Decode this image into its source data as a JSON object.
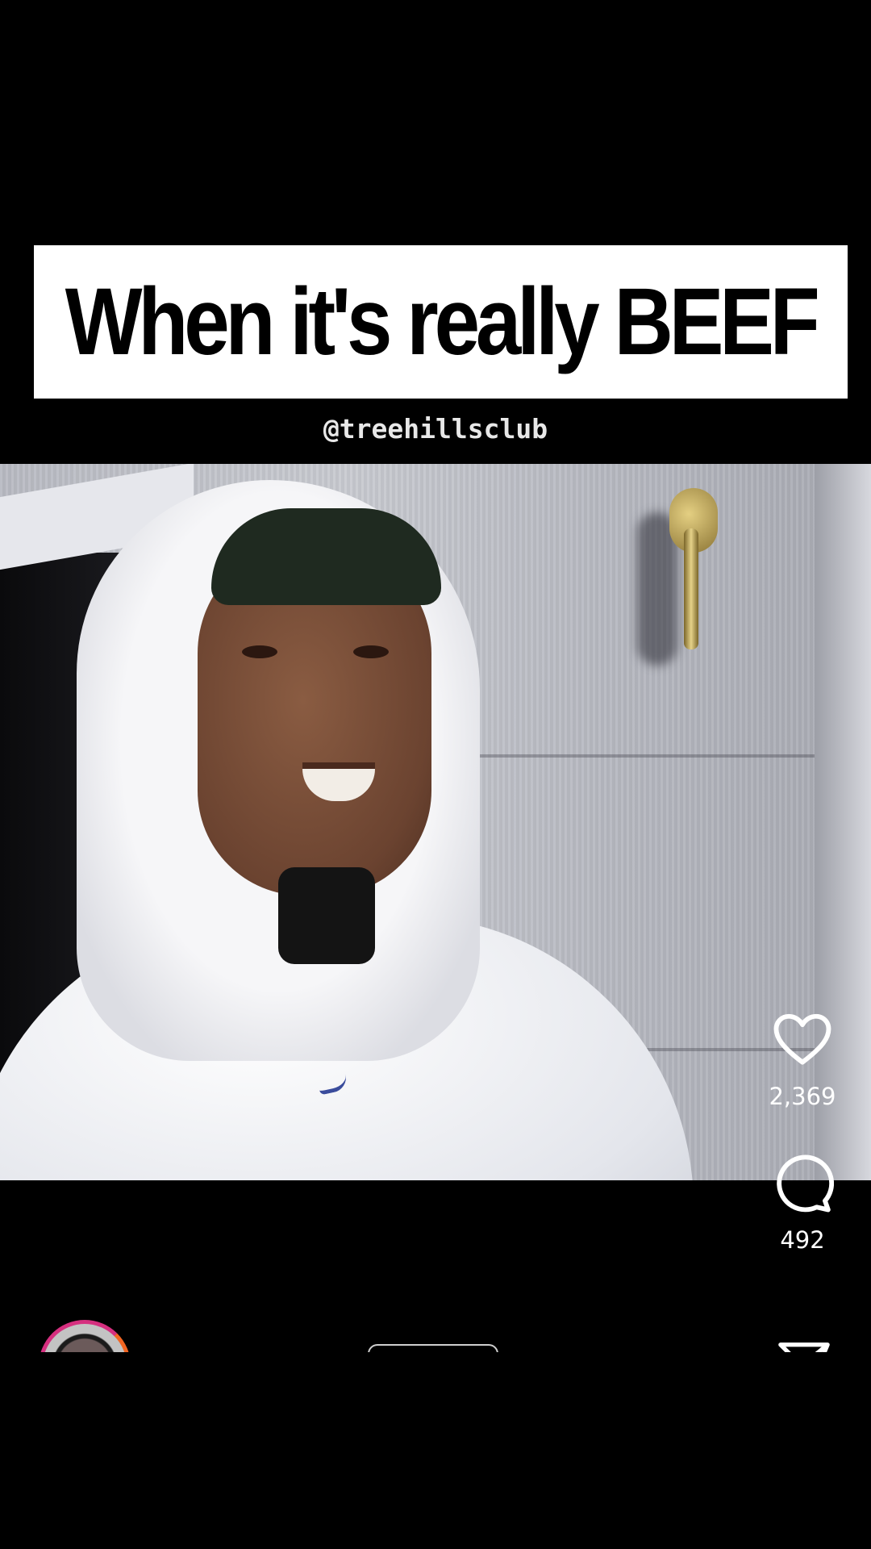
{
  "overlay": {
    "caption": "When it's really BEEF",
    "watermark": "@treehillsclub"
  },
  "actions": {
    "likes": {
      "icon": "heart-icon",
      "count": "2,369"
    },
    "comments": {
      "icon": "comment-bubble-icon",
      "count": "492"
    },
    "share": {
      "icon": "paper-plane-icon"
    }
  },
  "bottom": {
    "avatar_icon": "profile-avatar-story-ring",
    "pill_icon": "audio-pill"
  },
  "colors": {
    "background": "#000000",
    "caption_box": "#ffffff",
    "text_white": "#ffffff",
    "story_ring_start": "#d62f7f",
    "story_ring_end": "#f26522"
  }
}
